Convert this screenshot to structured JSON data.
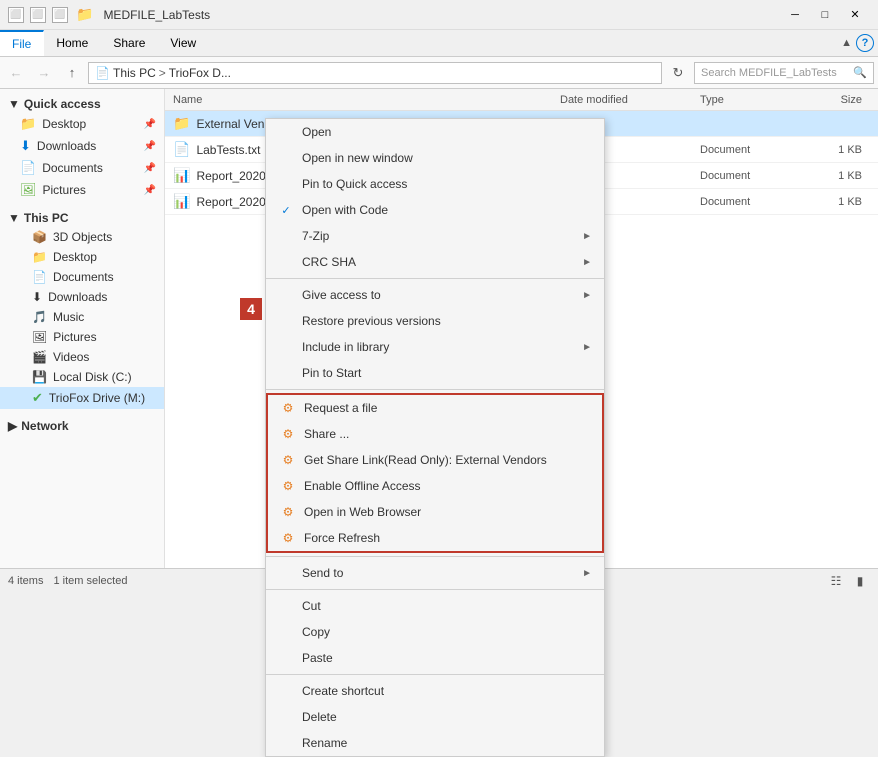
{
  "titleBar": {
    "title": "MEDFILE_LabTests",
    "windowControls": {
      "minimize": "─",
      "maximize": "□",
      "close": "✕"
    }
  },
  "ribbon": {
    "tabs": [
      "File",
      "Home",
      "Share",
      "View"
    ]
  },
  "addressBar": {
    "path": [
      "This PC",
      "TrioFox D..."
    ],
    "searchPlaceholder": "Search MEDFILE_LabTests"
  },
  "sidebar": {
    "quickAccess": "Quick access",
    "items": [
      {
        "label": "Desktop",
        "pinned": true
      },
      {
        "label": "Downloads",
        "pinned": true
      },
      {
        "label": "Documents",
        "pinned": true
      },
      {
        "label": "Pictures",
        "pinned": true
      }
    ],
    "thisPC": "This PC",
    "thisPCItems": [
      {
        "label": "3D Objects"
      },
      {
        "label": "Desktop"
      },
      {
        "label": "Documents"
      },
      {
        "label": "Downloads"
      },
      {
        "label": "Music"
      },
      {
        "label": "Pictures"
      },
      {
        "label": "Videos"
      },
      {
        "label": "Local Disk (C:)"
      },
      {
        "label": "TrioFox Drive (M:)",
        "active": true
      }
    ],
    "network": "Network"
  },
  "fileList": {
    "headers": [
      "Name",
      "Date modified",
      "Type",
      "Size"
    ],
    "files": [
      {
        "name": "External Ven...",
        "type": "folder",
        "date": "",
        "fileType": "",
        "size": ""
      },
      {
        "name": "LabTests.txt",
        "type": "txt",
        "date": "",
        "fileType": "Document",
        "size": "1 KB"
      },
      {
        "name": "Report_2020...",
        "type": "xlsx",
        "date": "",
        "fileType": "Document",
        "size": "1 KB"
      },
      {
        "name": "Report_2020...",
        "type": "xlsx",
        "date": "",
        "fileType": "Document",
        "size": "1 KB"
      }
    ]
  },
  "statusBar": {
    "itemCount": "4 items",
    "selected": "1 item selected"
  },
  "contextMenu": {
    "items": [
      {
        "label": "Open",
        "icon": ""
      },
      {
        "label": "Open in new window",
        "icon": ""
      },
      {
        "label": "Pin to Quick access",
        "icon": ""
      },
      {
        "label": "Open with Code",
        "icon": "vscode",
        "checkmark": true
      },
      {
        "label": "7-Zip",
        "icon": "",
        "hasArrow": true
      },
      {
        "label": "CRC SHA",
        "icon": "",
        "hasArrow": true
      },
      {
        "separator": true
      },
      {
        "label": "Give access to",
        "icon": "",
        "hasArrow": true
      },
      {
        "label": "Restore previous versions",
        "icon": ""
      },
      {
        "label": "Include in library",
        "icon": "",
        "hasArrow": true
      },
      {
        "label": "Pin to Start",
        "icon": ""
      },
      {
        "separator": true
      },
      {
        "label": "Request a file",
        "icon": "share",
        "grouped": true
      },
      {
        "label": "Share ...",
        "icon": "share",
        "grouped": true
      },
      {
        "label": "Get Share Link(Read Only): External Vendors",
        "icon": "share",
        "grouped": true
      },
      {
        "label": "Enable Offline Access",
        "icon": "share",
        "grouped": true
      },
      {
        "label": "Open in Web Browser",
        "icon": "share",
        "grouped": true
      },
      {
        "label": "Force Refresh",
        "icon": "share",
        "grouped": true
      },
      {
        "separator": true
      },
      {
        "label": "Send to",
        "icon": "",
        "hasArrow": true
      },
      {
        "separator": true
      },
      {
        "label": "Cut",
        "icon": ""
      },
      {
        "label": "Copy",
        "icon": ""
      },
      {
        "label": "Paste",
        "icon": ""
      },
      {
        "separator": true
      },
      {
        "label": "Create shortcut",
        "icon": ""
      },
      {
        "label": "Delete",
        "icon": ""
      },
      {
        "label": "Rename",
        "icon": ""
      }
    ],
    "badge": "4"
  }
}
